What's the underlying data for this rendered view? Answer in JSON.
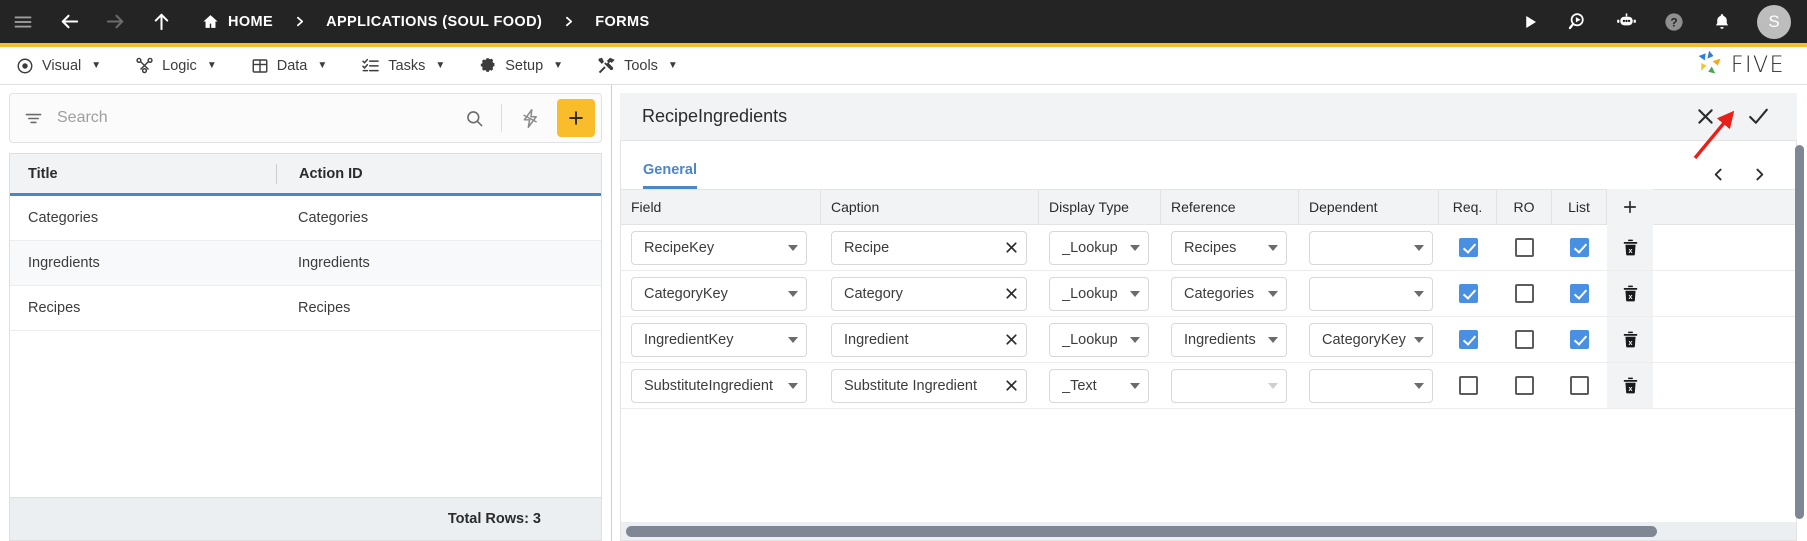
{
  "topbar": {
    "icons": [
      "menu-icon",
      "back-arrow-icon",
      "forward-arrow-icon",
      "up-arrow-icon"
    ],
    "breadcrumbs": [
      {
        "label": "HOME",
        "icon": "home-icon"
      },
      {
        "label": "APPLICATIONS (SOUL FOOD)"
      },
      {
        "label": "FORMS"
      }
    ],
    "right_icons": [
      "run-icon",
      "search-play-icon",
      "chatbot-icon",
      "help-icon",
      "bell-icon"
    ],
    "avatar_initial": "S"
  },
  "menubar": {
    "items": [
      {
        "label": "Visual",
        "icon": "eye-icon",
        "caret": "▼"
      },
      {
        "label": "Logic",
        "icon": "logic-icon",
        "caret": "▼"
      },
      {
        "label": "Data",
        "icon": "table-icon",
        "caret": "▼"
      },
      {
        "label": "Tasks",
        "icon": "tasks-icon",
        "caret": "▼"
      },
      {
        "label": "Setup",
        "icon": "gear-icon",
        "caret": "▼"
      },
      {
        "label": "Tools",
        "icon": "tools-icon",
        "caret": "▼"
      }
    ],
    "brand": "FIVE",
    "accent_color": "#f9bd2b"
  },
  "left_panel": {
    "search": {
      "value": "",
      "placeholder": "Search"
    },
    "add_button_label": "+",
    "columns": [
      "Title",
      "Action ID"
    ],
    "rows": [
      {
        "title": "Categories",
        "action_id": "Categories"
      },
      {
        "title": "Ingredients",
        "action_id": "Ingredients"
      },
      {
        "title": "Recipes",
        "action_id": "Recipes"
      }
    ],
    "total_rows_label": "Total Rows: 3"
  },
  "right_panel": {
    "title": "RecipeIngredients",
    "close_label": "✕",
    "save_label": "✓",
    "tabs": [
      {
        "label": "General",
        "active": true
      }
    ],
    "columns": [
      "Field",
      "Caption",
      "Display Type",
      "Reference",
      "Dependent",
      "Req.",
      "RO",
      "List",
      "+"
    ],
    "rows": [
      {
        "field": "RecipeKey",
        "caption": "Recipe",
        "display_type": "_Lookup",
        "reference": "Recipes",
        "dependent": "",
        "req": true,
        "ro": false,
        "list": true
      },
      {
        "field": "CategoryKey",
        "caption": "Category",
        "display_type": "_Lookup",
        "reference": "Categories",
        "dependent": "",
        "req": true,
        "ro": false,
        "list": true
      },
      {
        "field": "IngredientKey",
        "caption": "Ingredient",
        "display_type": "_Lookup",
        "reference": "Ingredients",
        "dependent": "CategoryKey",
        "req": true,
        "ro": false,
        "list": true
      },
      {
        "field": "SubstituteIngredient",
        "caption": "Substitute Ingredient",
        "display_type": "_Text",
        "reference": "",
        "dependent": "",
        "req": false,
        "ro": false,
        "list": false
      }
    ]
  },
  "colors": {
    "header_bg": "#242424",
    "accent_yellow": "#f9bd2b",
    "tab_blue": "#4a86c8",
    "checkbox_blue": "#4a90e2",
    "annotation_red": "#e8201a"
  }
}
